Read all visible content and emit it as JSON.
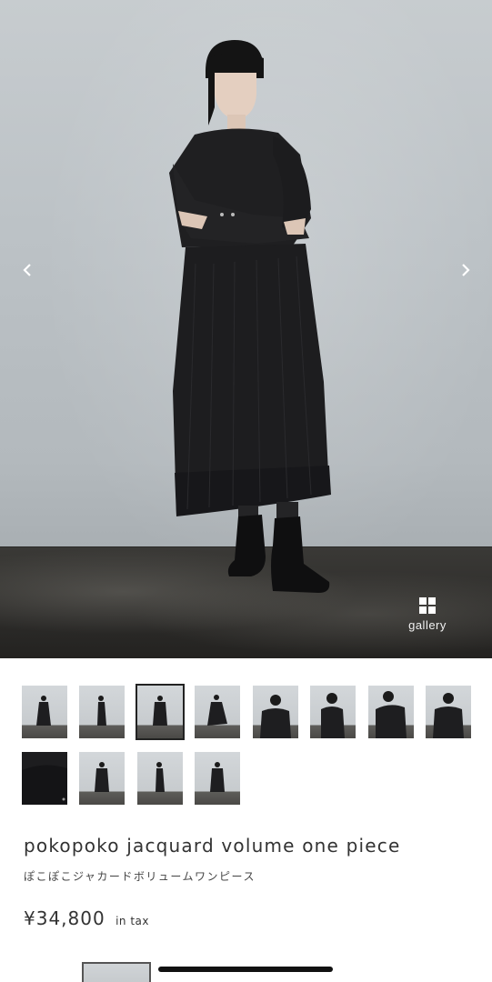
{
  "hero": {
    "prev_icon": "chevron-left-icon",
    "next_icon": "chevron-right-icon",
    "gallery_icon": "grid-icon",
    "gallery_label": "gallery"
  },
  "thumbnails": [
    {
      "pose": "standing-front",
      "selected": false
    },
    {
      "pose": "standing-side",
      "selected": false
    },
    {
      "pose": "standing-arms-crossed",
      "selected": true
    },
    {
      "pose": "walking",
      "selected": false
    },
    {
      "pose": "upper-body-front",
      "selected": false
    },
    {
      "pose": "upper-body-side",
      "selected": false
    },
    {
      "pose": "upper-body-arms-up",
      "selected": false
    },
    {
      "pose": "upper-body-back",
      "selected": false
    },
    {
      "pose": "fabric-detail",
      "selected": false
    },
    {
      "pose": "standing-front-full",
      "selected": false
    },
    {
      "pose": "standing-side-full",
      "selected": false
    },
    {
      "pose": "standing-back-full",
      "selected": false
    }
  ],
  "product": {
    "name": "pokopoko jacquard volume one piece",
    "name_ja": "ぽこぽこジャカードボリュームワンピース",
    "price": "¥34,800",
    "tax_label": "in tax"
  },
  "colors": {
    "dress": "#1e1e20",
    "wall": "#bcc2c6",
    "floor": "#2d2c2a",
    "text": "#333333"
  }
}
